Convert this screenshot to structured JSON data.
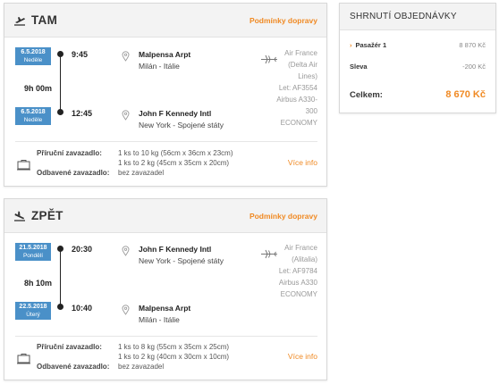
{
  "outbound": {
    "title": "TAM",
    "conditions_link": "Podmínky dopravy",
    "departure": {
      "date": "6.5.2018",
      "weekday": "Neděle",
      "time": "9:45",
      "airport": "Malpensa Arpt",
      "city": "Milán - Itálie"
    },
    "duration": "9h 00m",
    "arrival": {
      "date": "6.5.2018",
      "weekday": "Neděle",
      "time": "12:45",
      "airport": "John F Kennedy Intl",
      "city": "New York - Spojené státy"
    },
    "airline": {
      "line1": "Air France",
      "line2": "(Delta Air",
      "line3": "Lines)",
      "line4": "Let: AF3554",
      "line5": "Airbus A330-",
      "line6": "300",
      "line7": "ECONOMY"
    },
    "baggage": {
      "cabin_label": "Příruční zavazadlo:",
      "checked_label": "Odbavené zavazadlo:",
      "cabin_1": "1 ks to 10 kg (56cm x 36cm x 23cm)",
      "cabin_2": "1 ks to 2 kg (45cm x 35cm x 20cm)",
      "checked": "bez zavazadel",
      "more_info": "Více info"
    }
  },
  "inbound": {
    "title": "ZPĚT",
    "conditions_link": "Podmínky dopravy",
    "departure": {
      "date": "21.5.2018",
      "weekday": "Pondělí",
      "time": "20:30",
      "airport": "John F Kennedy Intl",
      "city": "New York - Spojené státy"
    },
    "duration": "8h 10m",
    "arrival": {
      "date": "22.5.2018",
      "weekday": "Úterý",
      "time": "10:40",
      "airport": "Malpensa Arpt",
      "city": "Milán - Itálie"
    },
    "airline": {
      "line1": "Air France",
      "line2": "(Alitalia)",
      "line3": "Let: AF9784",
      "line4": "Airbus A330",
      "line5": "ECONOMY"
    },
    "baggage": {
      "cabin_label": "Příruční zavazadlo:",
      "checked_label": "Odbavené zavazadlo:",
      "cabin_1": "1 ks to 8 kg (55cm x 35cm x 25cm)",
      "cabin_2": "1 ks to 2 kg (40cm x 30cm x 10cm)",
      "checked": "bez zavazadel",
      "more_info": "Více info"
    }
  },
  "summary": {
    "title": "SHRNUTÍ OBJEDNÁVKY",
    "passenger_label": "Pasažér 1",
    "passenger_price": "8 870 Kč",
    "discount_label": "Sleva",
    "discount_value": "-200 Kč",
    "total_label": "Celkem:",
    "total_value": "8 670 Kč"
  },
  "colors": {
    "accent": "#f08a24",
    "date_badge": "#4a90c8"
  }
}
